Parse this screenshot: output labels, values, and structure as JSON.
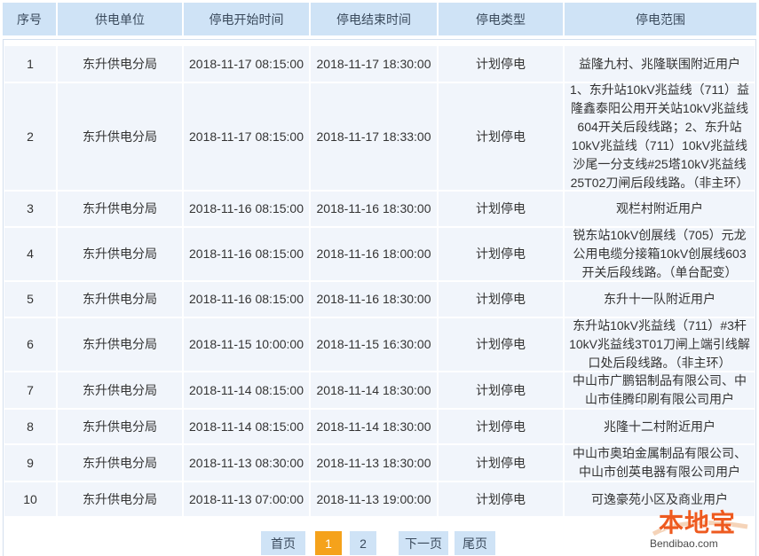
{
  "columns": [
    "序号",
    "供电单位",
    "停电开始时间",
    "停电结束时间",
    "停电类型",
    "停电范围"
  ],
  "rows": [
    {
      "no": "1",
      "unit": "东升供电分局",
      "start": "2018-11-17 08:15:00",
      "end": "2018-11-17 18:30:00",
      "type": "计划停电",
      "scope": "益隆九村、兆隆联围附近用户"
    },
    {
      "no": "2",
      "unit": "东升供电分局",
      "start": "2018-11-17 08:15:00",
      "end": "2018-11-17 18:33:00",
      "type": "计划停电",
      "scope": "1、东升站10kV兆益线（711）益隆鑫泰阳公用开关站10kV兆益线604开关后段线路；2、东升站10kV兆益线（711）10kV兆益线沙尾一分支线#25塔10kV兆益线25T02刀闸后段线路。（非主环）"
    },
    {
      "no": "3",
      "unit": "东升供电分局",
      "start": "2018-11-16 08:15:00",
      "end": "2018-11-16 18:30:00",
      "type": "计划停电",
      "scope": "观栏村附近用户"
    },
    {
      "no": "4",
      "unit": "东升供电分局",
      "start": "2018-11-16 08:15:00",
      "end": "2018-11-16 18:00:00",
      "type": "计划停电",
      "scope": "锐东站10kV创展线（705）元龙公用电缆分接箱10kV创展线603开关后段线路。（单台配变）"
    },
    {
      "no": "5",
      "unit": "东升供电分局",
      "start": "2018-11-16 08:15:00",
      "end": "2018-11-16 18:30:00",
      "type": "计划停电",
      "scope": "东升十一队附近用户"
    },
    {
      "no": "6",
      "unit": "东升供电分局",
      "start": "2018-11-15 10:00:00",
      "end": "2018-11-15 16:30:00",
      "type": "计划停电",
      "scope": "东升站10kV兆益线（711）#3杆10kV兆益线3T01刀闸上端引线解口处后段线路。（非主环）"
    },
    {
      "no": "7",
      "unit": "东升供电分局",
      "start": "2018-11-14 08:15:00",
      "end": "2018-11-14 18:30:00",
      "type": "计划停电",
      "scope": "中山市广鹏铝制品有限公司、中山市佳腾印刷有限公司用户"
    },
    {
      "no": "8",
      "unit": "东升供电分局",
      "start": "2018-11-14 08:15:00",
      "end": "2018-11-14 18:30:00",
      "type": "计划停电",
      "scope": "兆隆十二村附近用户"
    },
    {
      "no": "9",
      "unit": "东升供电分局",
      "start": "2018-11-13 08:30:00",
      "end": "2018-11-13 18:30:00",
      "type": "计划停电",
      "scope": "中山市奥珀金属制品有限公司、中山市创英电器有限公司用户"
    },
    {
      "no": "10",
      "unit": "东升供电分局",
      "start": "2018-11-13 07:00:00",
      "end": "2018-11-13 19:00:00",
      "type": "计划停电",
      "scope": "可逸豪苑小区及商业用户"
    }
  ],
  "pagination": {
    "first": "首页",
    "page1": "1",
    "page2": "2",
    "next": "下一页",
    "last": "尾页"
  },
  "watermark": {
    "main": "本地宝",
    "sub": "Bendibao.com"
  },
  "colors": {
    "header_bg": "#cfe3f6",
    "cell_bg": "#f1f5fb",
    "active_page": "#f5a21b"
  }
}
